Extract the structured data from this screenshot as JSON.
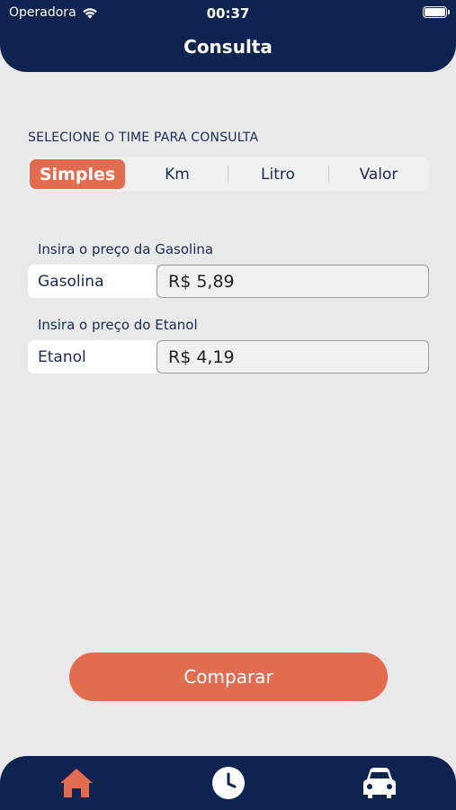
{
  "status_bar": {
    "carrier": "Operadora",
    "time": "00:37"
  },
  "header": {
    "title": "Consulta"
  },
  "selector": {
    "label": "SELECIONE O TIME PARA CONSULTA",
    "options": [
      "Simples",
      "Km",
      "Litro",
      "Valor"
    ],
    "selected": "Simples"
  },
  "gasolina": {
    "prompt": "Insira o preço da Gasolina",
    "name": "Gasolina",
    "value": "R$ 5,89"
  },
  "etanol": {
    "prompt": "Insira o preço do Etanol",
    "name": "Etanol",
    "value": "R$ 4,19"
  },
  "compare_button": "Comparar",
  "tabbar": {
    "items": [
      "home-icon",
      "clock-icon",
      "car-icon"
    ],
    "active": "home-icon"
  },
  "colors": {
    "navy": "#0f2451",
    "accent": "#e26b50",
    "background": "#e9e9e9"
  }
}
